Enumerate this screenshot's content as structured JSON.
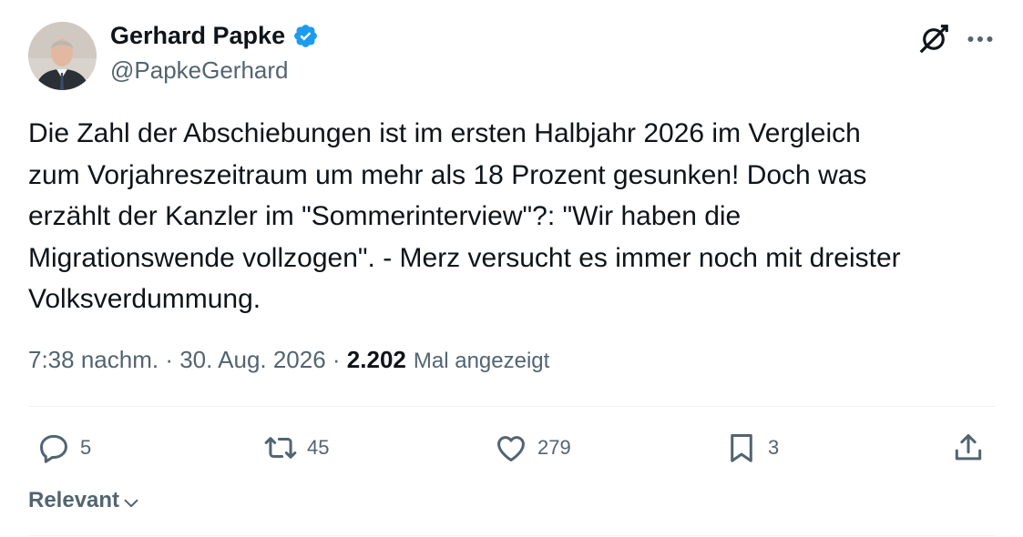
{
  "author": {
    "name": "Gerhard Papke",
    "handle": "@PapkeGerhard"
  },
  "tweet": {
    "text": "Die Zahl der Abschiebungen ist im ersten Halbjahr 2026 im Vergleich\nzum Vorjahreszeitraum um mehr als 18 Prozent gesunken! Doch was\nerzählt der Kanzler im \"Sommerinterview\"?: \"Wir haben die\nMigrationswende vollzogen\". - Merz versucht es immer noch mit dreister\nVolksverdummung."
  },
  "meta": {
    "time": "7:38 nachm.",
    "separator": " · ",
    "date": "30. Aug. 2026",
    "views_count": "2.202",
    "views_label": "Mal angezeigt"
  },
  "actions": {
    "replies": "5",
    "reposts": "45",
    "likes": "279",
    "bookmarks": "3"
  },
  "sort": {
    "label": "Relevant"
  },
  "colors": {
    "text": "#0f1419",
    "secondary": "#536471",
    "verified": "#1d9bf0",
    "divider": "#eff3f4"
  }
}
